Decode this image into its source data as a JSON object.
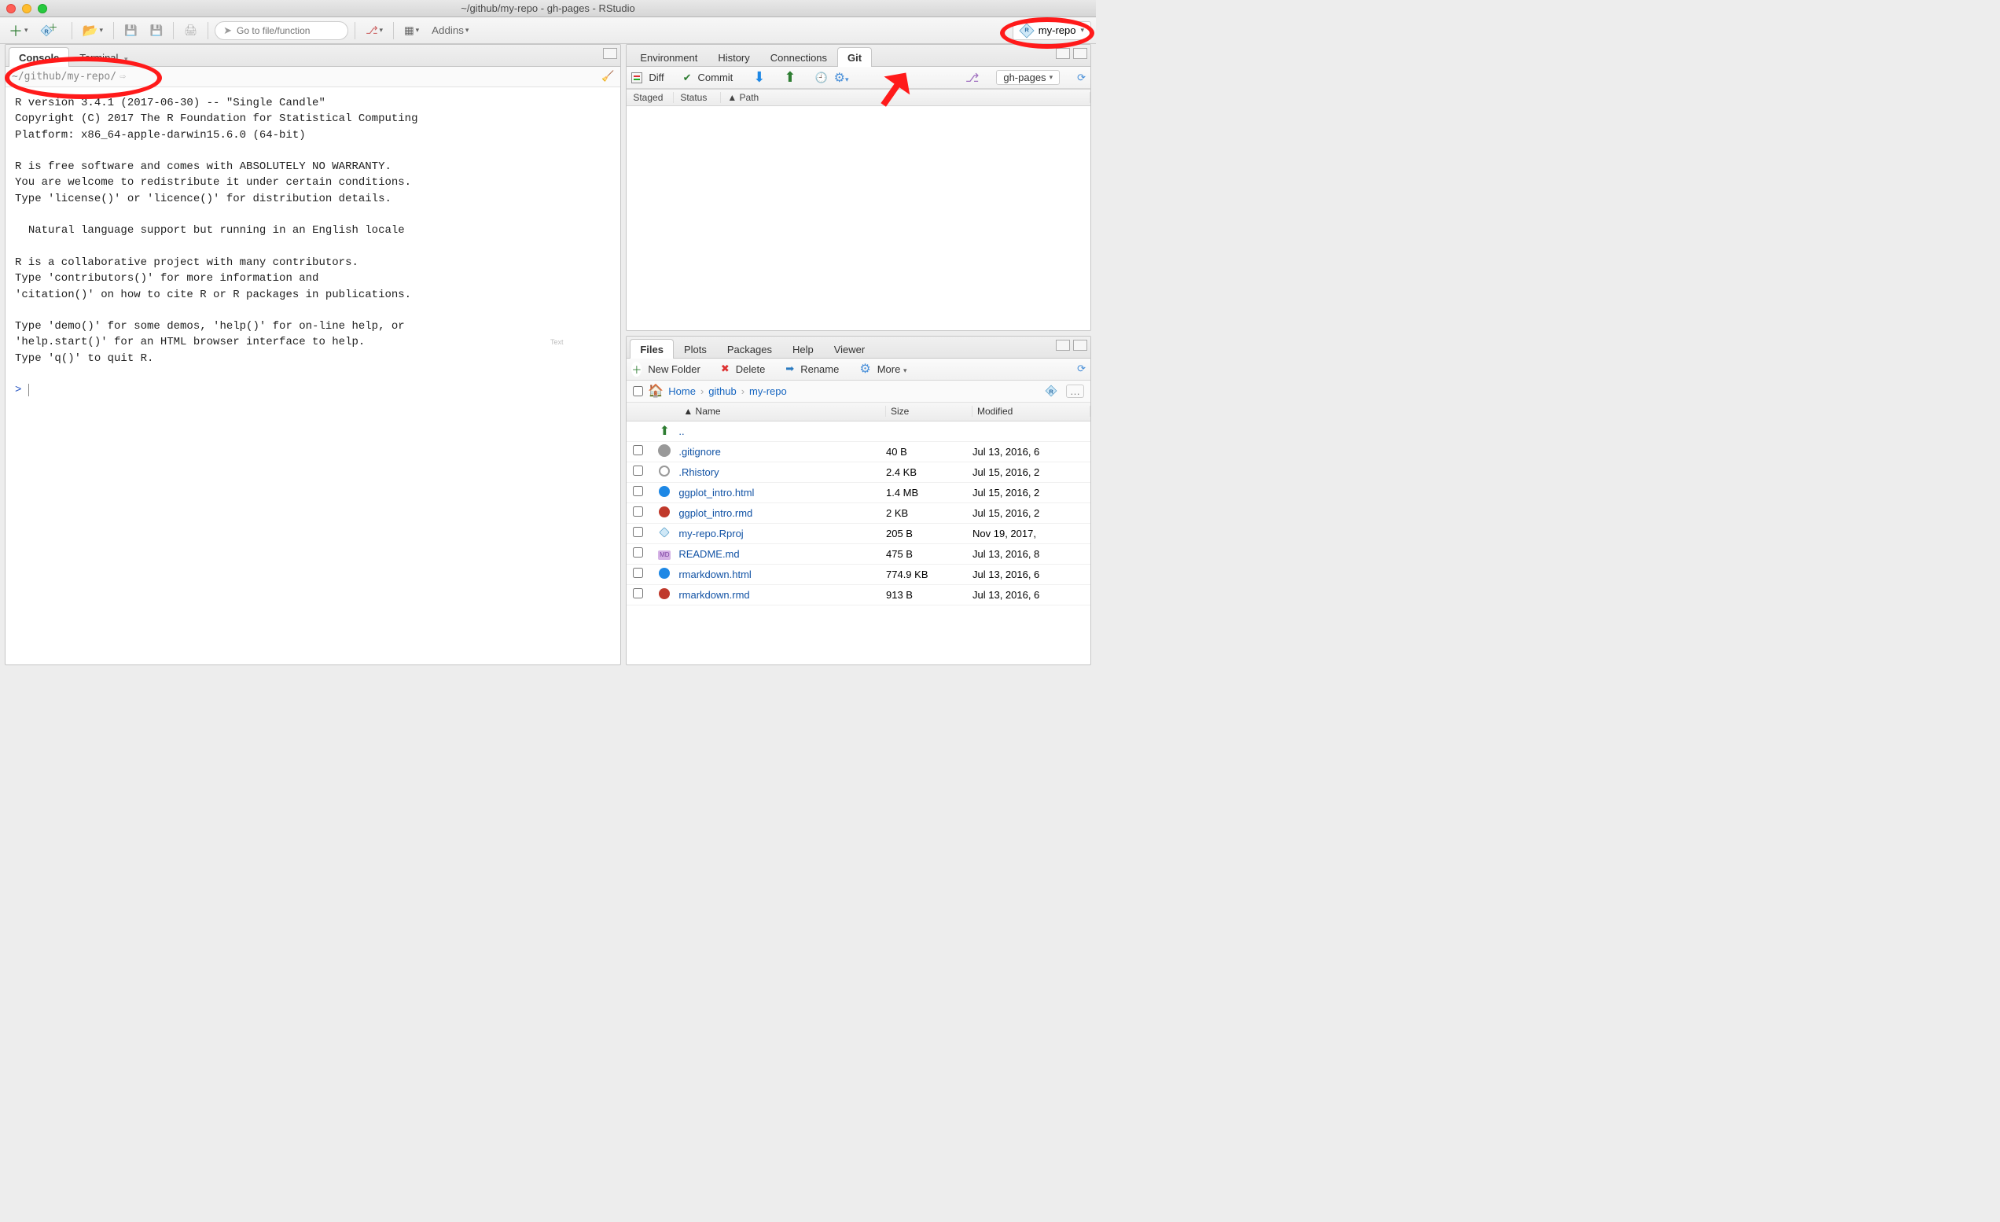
{
  "window": {
    "title": "~/github/my-repo - gh-pages - RStudio"
  },
  "toolbar": {
    "goto_placeholder": "Go to file/function",
    "addins_label": "Addins",
    "project_label": "my-repo"
  },
  "console": {
    "tabs": {
      "console": "Console",
      "terminal": "Terminal"
    },
    "path": "~/github/my-repo/",
    "body": "R version 3.4.1 (2017-06-30) -- \"Single Candle\"\nCopyright (C) 2017 The R Foundation for Statistical Computing\nPlatform: x86_64-apple-darwin15.6.0 (64-bit)\n\nR is free software and comes with ABSOLUTELY NO WARRANTY.\nYou are welcome to redistribute it under certain conditions.\nType 'license()' or 'licence()' for distribution details.\n\n  Natural language support but running in an English locale\n\nR is a collaborative project with many contributors.\nType 'contributors()' for more information and\n'citation()' on how to cite R or R packages in publications.\n\nType 'demo()' for some demos, 'help()' for on-line help, or\n'help.start()' for an HTML browser interface to help.\nType 'q()' to quit R.\n",
    "prompt": "> "
  },
  "env_pane": {
    "tabs": {
      "environment": "Environment",
      "history": "History",
      "connections": "Connections",
      "git": "Git"
    },
    "git_toolbar": {
      "diff": "Diff",
      "commit": "Commit",
      "branch": "gh-pages"
    },
    "git_columns": {
      "staged": "Staged",
      "status": "Status",
      "path": "Path"
    }
  },
  "files_pane": {
    "tabs": {
      "files": "Files",
      "plots": "Plots",
      "packages": "Packages",
      "help": "Help",
      "viewer": "Viewer"
    },
    "toolbar": {
      "new_folder": "New Folder",
      "delete": "Delete",
      "rename": "Rename",
      "more": "More"
    },
    "breadcrumb": {
      "home": "Home",
      "p1": "github",
      "p2": "my-repo"
    },
    "columns": {
      "name": "Name",
      "size": "Size",
      "modified": "Modified"
    },
    "rows": [
      {
        "icon": "up",
        "name": "..",
        "size": "",
        "modified": ""
      },
      {
        "icon": "gear",
        "name": ".gitignore",
        "size": "40 B",
        "modified": "Jul 13, 2016, 6"
      },
      {
        "icon": "hist",
        "name": ".Rhistory",
        "size": "2.4 KB",
        "modified": "Jul 15, 2016, 2"
      },
      {
        "icon": "html",
        "name": "ggplot_intro.html",
        "size": "1.4 MB",
        "modified": "Jul 15, 2016, 2"
      },
      {
        "icon": "rmd",
        "name": "ggplot_intro.rmd",
        "size": "2 KB",
        "modified": "Jul 15, 2016, 2"
      },
      {
        "icon": "proj",
        "name": "my-repo.Rproj",
        "size": "205 B",
        "modified": "Nov 19, 2017,"
      },
      {
        "icon": "md",
        "name": "README.md",
        "size": "475 B",
        "modified": "Jul 13, 2016, 8"
      },
      {
        "icon": "html",
        "name": "rmarkdown.html",
        "size": "774.9 KB",
        "modified": "Jul 13, 2016, 6"
      },
      {
        "icon": "rmd",
        "name": "rmarkdown.rmd",
        "size": "913 B",
        "modified": "Jul 13, 2016, 6"
      }
    ]
  },
  "watermark": "Text"
}
